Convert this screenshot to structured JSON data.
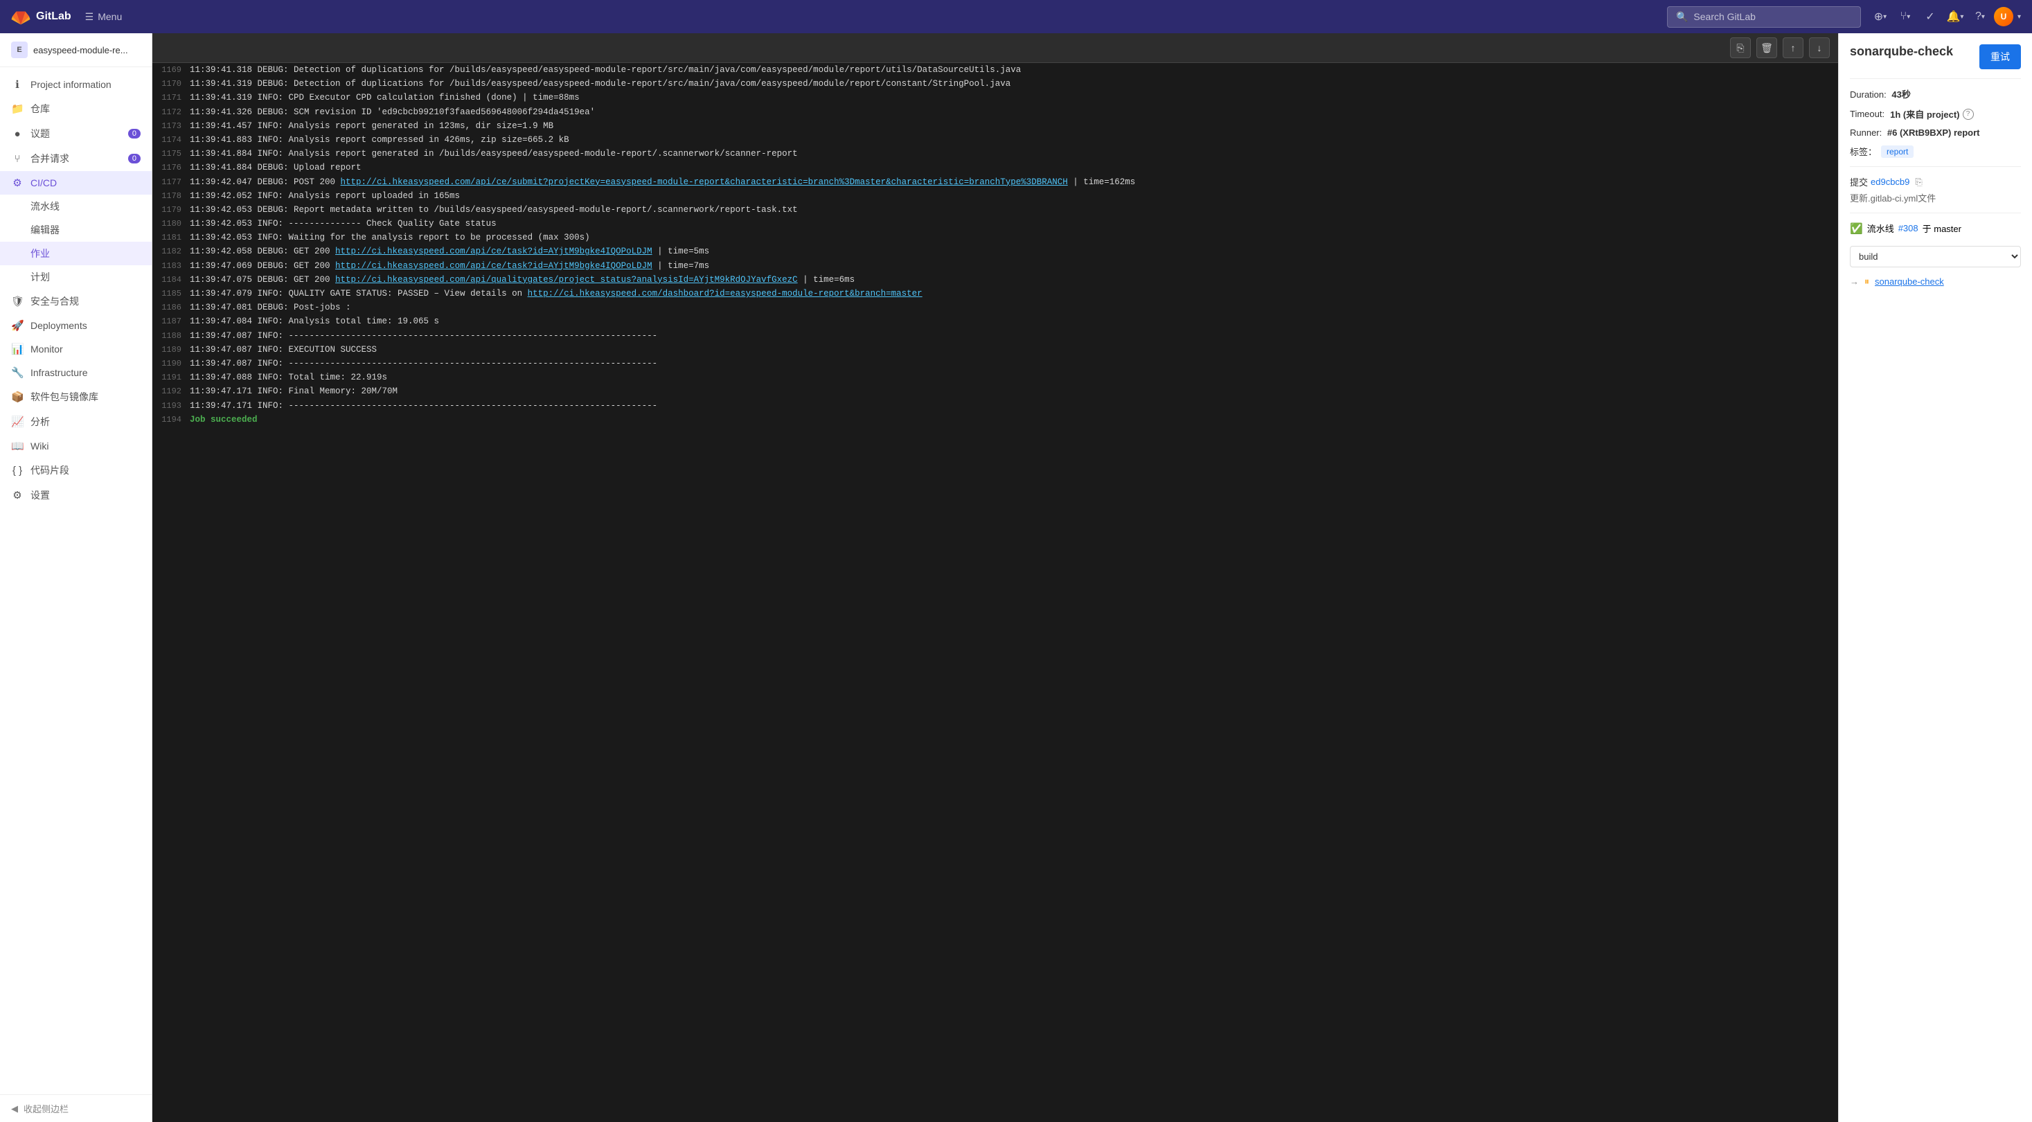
{
  "nav": {
    "logo_text": "GitLab",
    "menu_label": "Menu",
    "search_placeholder": "Search GitLab",
    "icons": [
      "plus",
      "merge",
      "check",
      "bell",
      "user"
    ]
  },
  "sidebar": {
    "project_name": "easyspeed-module-re...",
    "project_initial": "E",
    "items": [
      {
        "id": "project-info",
        "label": "Project information",
        "icon": "ℹ"
      },
      {
        "id": "repo",
        "label": "仓库",
        "icon": "📁"
      },
      {
        "id": "issues",
        "label": "议题",
        "icon": "●",
        "badge": "0"
      },
      {
        "id": "merge-requests",
        "label": "合并请求",
        "icon": "⑂",
        "badge": "0"
      },
      {
        "id": "cicd",
        "label": "CI/CD",
        "icon": "⚙",
        "active": true,
        "children": [
          {
            "id": "pipelines",
            "label": "流水线"
          },
          {
            "id": "editor",
            "label": "编辑器"
          },
          {
            "id": "jobs",
            "label": "作业",
            "active": true
          },
          {
            "id": "schedules",
            "label": "计划"
          }
        ]
      },
      {
        "id": "security",
        "label": "安全与合规",
        "icon": "🛡"
      },
      {
        "id": "deployments",
        "label": "Deployments",
        "icon": "🚀"
      },
      {
        "id": "monitor",
        "label": "Monitor",
        "icon": "📊"
      },
      {
        "id": "infrastructure",
        "label": "Infrastructure",
        "icon": "🔧"
      },
      {
        "id": "packages",
        "label": "软件包与镜像库",
        "icon": "📦"
      },
      {
        "id": "analytics",
        "label": "分析",
        "icon": "📈"
      },
      {
        "id": "wiki",
        "label": "Wiki",
        "icon": "📖"
      },
      {
        "id": "snippets",
        "label": "代码片段",
        "icon": "{ }"
      },
      {
        "id": "settings",
        "label": "设置",
        "icon": "⚙"
      }
    ],
    "collapse_label": "收起侧边栏"
  },
  "log": {
    "toolbar_buttons": [
      "copy",
      "delete",
      "scroll-top",
      "scroll-bottom"
    ],
    "lines": [
      {
        "num": 1169,
        "text": "11:39:41.318 DEBUG: Detection of duplications for /builds/easyspeed/easyspeed-module-report/src/main/java/com/easyspeed/module/report/utils/DataSourceUtils.java"
      },
      {
        "num": 1170,
        "text": "11:39:41.319 DEBUG: Detection of duplications for /builds/easyspeed/easyspeed-module-report/src/main/java/com/easyspeed/module/report/constant/StringPool.java"
      },
      {
        "num": 1171,
        "text": "11:39:41.319 INFO: CPD Executor CPD calculation finished (done) | time=88ms"
      },
      {
        "num": 1172,
        "text": "11:39:41.326 DEBUG: SCM revision ID 'ed9cbcb99210f3faaed569648006f294da4519ea'"
      },
      {
        "num": 1173,
        "text": "11:39:41.457 INFO: Analysis report generated in 123ms, dir size=1.9 MB"
      },
      {
        "num": 1174,
        "text": "11:39:41.883 INFO: Analysis report compressed in 426ms, zip size=665.2 kB"
      },
      {
        "num": 1175,
        "text": "11:39:41.884 INFO: Analysis report generated in /builds/easyspeed/easyspeed-module-report/.scannerwork/scanner-report"
      },
      {
        "num": 1176,
        "text": "11:39:41.884 DEBUG: Upload report"
      },
      {
        "num": 1177,
        "text": "11:39:42.047 DEBUG: POST 200 http://ci.hkeasyspeed.com/api/ce/submit?projectKey=easyspeed-module-report&characteristic=branch%3Dmaster&characteristic=branchType%3DBRANCH | time=162ms",
        "has_link": true,
        "link": "http://ci.hkeasyspeed.com/api/ce/submit?projectKey=easyspeed-module-report&characteristic=branch%3Dmaster&characteristic=branchType%3DBRANCH"
      },
      {
        "num": 1178,
        "text": "11:39:42.052 INFO: Analysis report uploaded in 165ms"
      },
      {
        "num": 1179,
        "text": "11:39:42.053 DEBUG: Report metadata written to /builds/easyspeed/easyspeed-module-report/.scannerwork/report-task.txt"
      },
      {
        "num": 1180,
        "text": "11:39:42.053 INFO: -------------- Check Quality Gate status"
      },
      {
        "num": 1181,
        "text": "11:39:42.053 INFO: Waiting for the analysis report to be processed (max 300s)"
      },
      {
        "num": 1182,
        "text": "11:39:42.058 DEBUG: GET 200 http://ci.hkeasyspeed.com/api/ce/task?id=AYjtM9bgke4IQOPoLDJM | time=5ms",
        "has_link": true,
        "link": "http://ci.hkeasyspeed.com/api/ce/task?id=AYjtM9bgke4IQOPoLDJM"
      },
      {
        "num": 1183,
        "text": "11:39:47.069 DEBUG: GET 200 http://ci.hkeasyspeed.com/api/ce/task?id=AYjtM9bgke4IQOPoLDJM | time=7ms",
        "has_link": true,
        "link": "http://ci.hkeasyspeed.com/api/ce/task?id=AYjtM9bgke4IQOPoLDJM"
      },
      {
        "num": 1184,
        "text": "11:39:47.075 DEBUG: GET 200 http://ci.hkeasyspeed.com/api/qualitygates/project_status?analysisId=AYjtM9kRdOJYavfGxezC | time=6ms",
        "has_link": true,
        "link": "http://ci.hkeasyspeed.com/api/qualitygates/project_status?analysisId=AYjtM9kRdOJYavfGxezC"
      },
      {
        "num": 1185,
        "text": "11:39:47.079 INFO: QUALITY GATE STATUS: PASSED – View details on http://ci.hkeasyspeed.com/dashboard?id=easyspeed-module-report&branch=master",
        "has_link": true,
        "link": "http://ci.hkeasyspeed.com/dashboard?id=easyspeed-module-report&branch=master"
      },
      {
        "num": 1186,
        "text": "11:39:47.081 DEBUG: Post-jobs :"
      },
      {
        "num": 1187,
        "text": "11:39:47.084 INFO: Analysis total time: 19.065 s"
      },
      {
        "num": 1188,
        "text": "11:39:47.087 INFO: -----------------------------------------------------------------------"
      },
      {
        "num": 1189,
        "text": "11:39:47.087 INFO: EXECUTION SUCCESS"
      },
      {
        "num": 1190,
        "text": "11:39:47.087 INFO: -----------------------------------------------------------------------"
      },
      {
        "num": 1191,
        "text": "11:39:47.088 INFO: Total time: 22.919s"
      },
      {
        "num": 1192,
        "text": "11:39:47.171 INFO: Final Memory: 20M/70M"
      },
      {
        "num": 1193,
        "text": "11:39:47.171 INFO: -----------------------------------------------------------------------"
      },
      {
        "num": 1194,
        "text": "Job succeeded",
        "type": "success"
      }
    ]
  },
  "right_panel": {
    "title": "sonarqube-check",
    "retry_label": "重试",
    "duration_label": "Duration:",
    "duration_value": "43秒",
    "timeout_label": "Timeout:",
    "timeout_value": "1h (来自 project)",
    "runner_label": "Runner:",
    "runner_value": "#6 (XRtB9BXP) report",
    "tags_label": "标签：",
    "tag_value": "report",
    "commit_label": "提交",
    "commit_hash": "ed9cbcb9",
    "update_label": "更新.gitlab-ci.yml文件",
    "pipeline_label": "流水线",
    "pipeline_num": "#308",
    "pipeline_branch": "于 master",
    "build_select_value": "build",
    "job_arrow_label": "→",
    "job_status_icon": "⏸",
    "job_link": "sonarqube-check",
    "help_icon": "?",
    "info_icon": "ℹ"
  }
}
